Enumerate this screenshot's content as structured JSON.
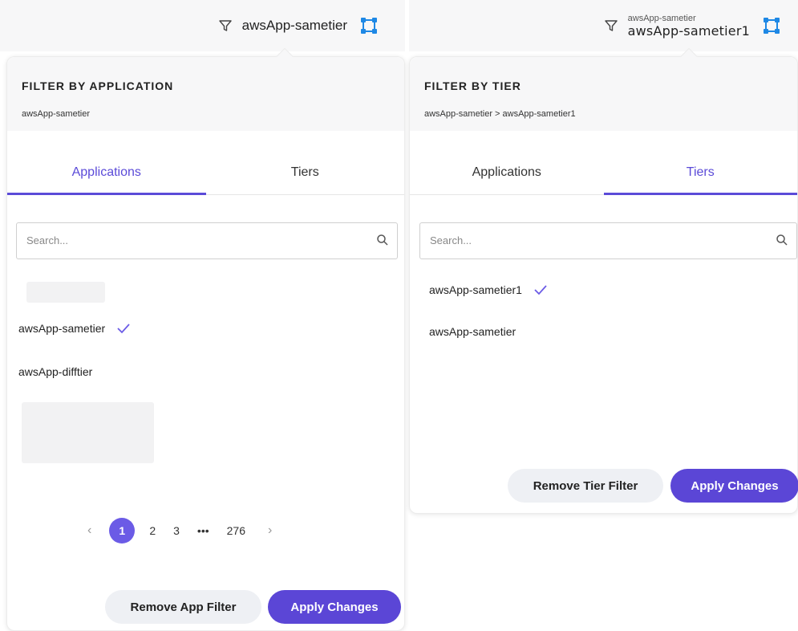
{
  "left_panel": {
    "topbar": {
      "app_name": "awsApp-sametier"
    },
    "header": {
      "heading": "FILTER BY APPLICATION",
      "path": "awsApp-sametier"
    },
    "tabs": [
      {
        "label": "Applications",
        "active": true
      },
      {
        "label": "Tiers",
        "active": false
      }
    ],
    "search": {
      "placeholder": "Search..."
    },
    "list": [
      {
        "label": "awsApp-sametier",
        "selected": true
      },
      {
        "label": "awsApp-difftier",
        "selected": false
      }
    ],
    "pagination": {
      "prev": "‹",
      "current": "1",
      "pages": [
        "2",
        "3",
        "•••",
        "276"
      ],
      "next": "›"
    },
    "buttons": {
      "remove": "Remove App Filter",
      "apply": "Apply Changes"
    }
  },
  "right_panel": {
    "topbar": {
      "app_name": "awsApp-sametier",
      "tier_name": "awsApp-sametier1"
    },
    "header": {
      "heading": "FILTER BY TIER",
      "path": "awsApp-sametier > awsApp-sametier1"
    },
    "tabs": [
      {
        "label": "Applications",
        "active": false
      },
      {
        "label": "Tiers",
        "active": true
      }
    ],
    "search": {
      "placeholder": "Search..."
    },
    "list": [
      {
        "label": "awsApp-sametier1",
        "selected": true
      },
      {
        "label": "awsApp-sametier",
        "selected": false
      }
    ],
    "buttons": {
      "remove": "Remove Tier Filter",
      "apply": "Apply Changes"
    }
  },
  "icons": {
    "filter": "filter-icon",
    "topology": "topology-icon",
    "search": "search-icon",
    "check": "check-icon"
  },
  "colors": {
    "accent": "#5b46d6",
    "topology_icon": "#1e88e5",
    "background": "#f7f7f8"
  }
}
